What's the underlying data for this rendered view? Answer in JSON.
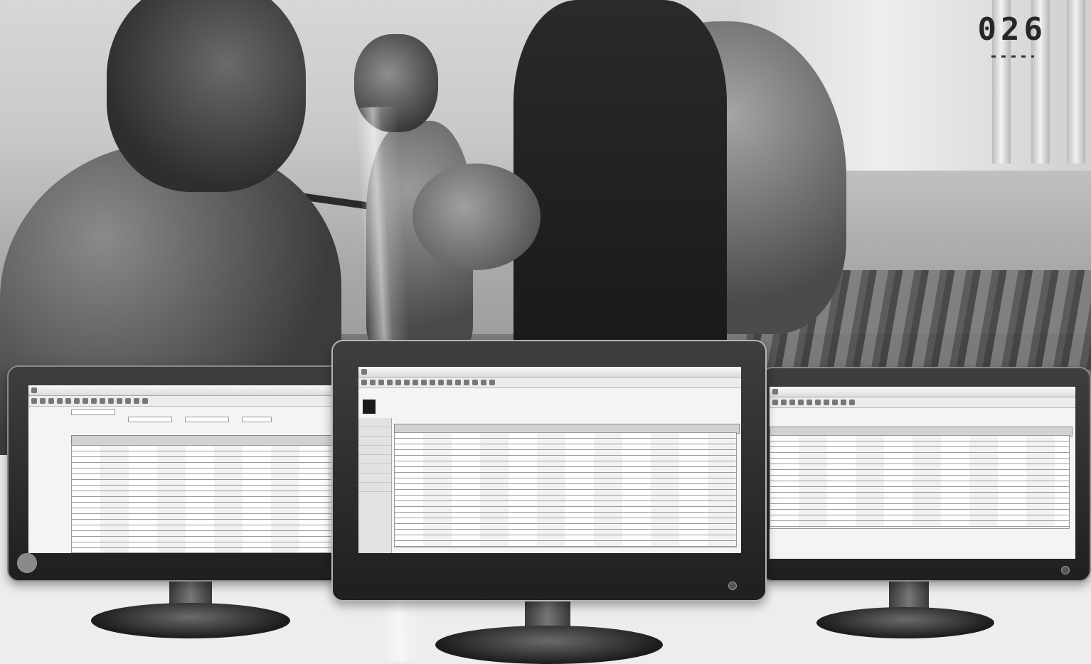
{
  "page": {
    "number": "026"
  },
  "monitors": {
    "left": {
      "toolbar_icon_count": 14,
      "column_headers": [
        "",
        "",
        "",
        "",
        "",
        "",
        "",
        "",
        "",
        ""
      ],
      "row_count": 22
    },
    "center": {
      "toolbar_icon_count": 16,
      "side_item_count": 8,
      "row_count": 20
    },
    "right": {
      "toolbar_icon_count": 10,
      "row_count": 14
    }
  }
}
